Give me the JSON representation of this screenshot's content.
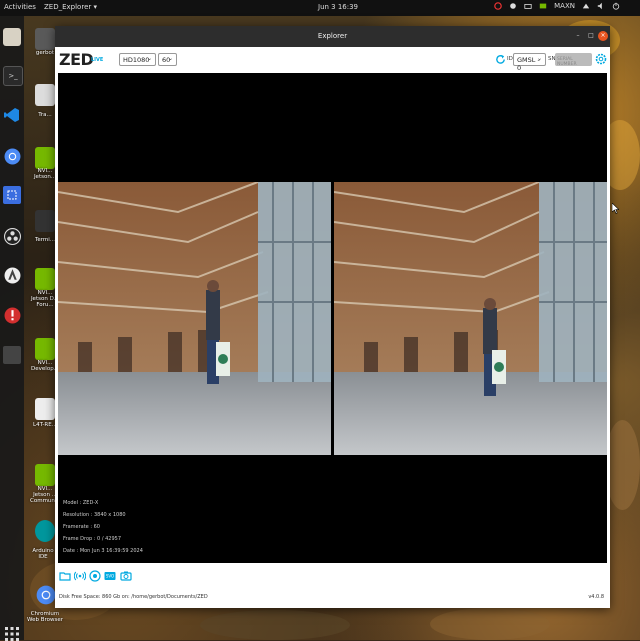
{
  "topbar": {
    "activities": "Activities",
    "app_menu": "ZED_Explorer ▾",
    "clock": "Jun 3 16:39",
    "power_mode": "MAXN"
  },
  "dock": {
    "items": [
      "files-icon",
      "terminal-icon",
      "vscode-icon",
      "chromium-icon",
      "screenshot-icon",
      "obs-icon",
      "updates-icon",
      "help-icon",
      "apps-grid-icon"
    ]
  },
  "desktop": {
    "icons": [
      {
        "label": "gerbot"
      },
      {
        "label": "Tra..."
      },
      {
        "label": "NVI... Jetson..."
      },
      {
        "label": "Termi..."
      },
      {
        "label": "NVI... Jetson D... Foru..."
      },
      {
        "label": "NVI... Develop..."
      },
      {
        "label": "L4T-RE..."
      },
      {
        "label": "NVI... Jetson ... Commun..."
      },
      {
        "label": "Arduino IDE"
      },
      {
        "label": "Chromium Web Browser"
      }
    ]
  },
  "window": {
    "title": "Explorer",
    "minimize": "–",
    "maximize": "□",
    "close": "×"
  },
  "toolbar": {
    "logo": "ZED",
    "live": "LIVE",
    "resolution": "HD1080",
    "fps": "60",
    "id_label": "ID",
    "camera": "GMSL - 0",
    "sn_label": "SN",
    "sn_placeholder": "SERIAL NUMBER"
  },
  "camera_info": {
    "model": "Model : ZED-X",
    "resolution": "Resolution : 3840 x 1080",
    "framerate": "Framerate : 60",
    "frame_drop": "Frame Drop : 0 / 42957",
    "date": "Date : Mon Jun 3 16:39:59 2024"
  },
  "bottom": {
    "icons": [
      "folder-icon",
      "stream-icon",
      "record-icon",
      "svo-icon",
      "snapshot-icon"
    ],
    "status": "Disk Free Space: 860 Gb   on: /home/gerbot/Documents/ZED",
    "version": "v4.0.8"
  },
  "colors": {
    "accent": "#00a9e0",
    "close_button": "#e95420",
    "topbar": "#111111",
    "titlebar": "#2d2d2d"
  }
}
